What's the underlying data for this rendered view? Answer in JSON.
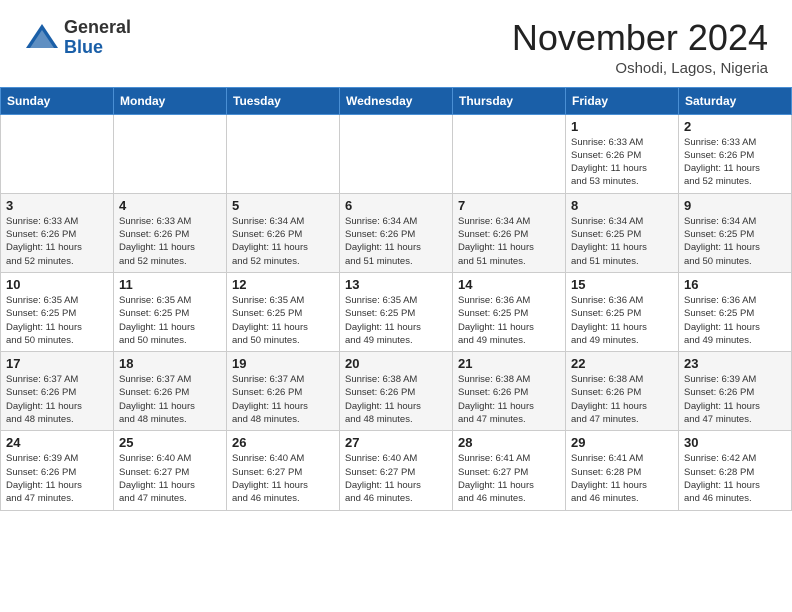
{
  "header": {
    "logo_general": "General",
    "logo_blue": "Blue",
    "month_title": "November 2024",
    "location": "Oshodi, Lagos, Nigeria"
  },
  "weekdays": [
    "Sunday",
    "Monday",
    "Tuesday",
    "Wednesday",
    "Thursday",
    "Friday",
    "Saturday"
  ],
  "weeks": [
    [
      {
        "day": "",
        "info": ""
      },
      {
        "day": "",
        "info": ""
      },
      {
        "day": "",
        "info": ""
      },
      {
        "day": "",
        "info": ""
      },
      {
        "day": "",
        "info": ""
      },
      {
        "day": "1",
        "info": "Sunrise: 6:33 AM\nSunset: 6:26 PM\nDaylight: 11 hours\nand 53 minutes."
      },
      {
        "day": "2",
        "info": "Sunrise: 6:33 AM\nSunset: 6:26 PM\nDaylight: 11 hours\nand 52 minutes."
      }
    ],
    [
      {
        "day": "3",
        "info": "Sunrise: 6:33 AM\nSunset: 6:26 PM\nDaylight: 11 hours\nand 52 minutes."
      },
      {
        "day": "4",
        "info": "Sunrise: 6:33 AM\nSunset: 6:26 PM\nDaylight: 11 hours\nand 52 minutes."
      },
      {
        "day": "5",
        "info": "Sunrise: 6:34 AM\nSunset: 6:26 PM\nDaylight: 11 hours\nand 52 minutes."
      },
      {
        "day": "6",
        "info": "Sunrise: 6:34 AM\nSunset: 6:26 PM\nDaylight: 11 hours\nand 51 minutes."
      },
      {
        "day": "7",
        "info": "Sunrise: 6:34 AM\nSunset: 6:26 PM\nDaylight: 11 hours\nand 51 minutes."
      },
      {
        "day": "8",
        "info": "Sunrise: 6:34 AM\nSunset: 6:25 PM\nDaylight: 11 hours\nand 51 minutes."
      },
      {
        "day": "9",
        "info": "Sunrise: 6:34 AM\nSunset: 6:25 PM\nDaylight: 11 hours\nand 50 minutes."
      }
    ],
    [
      {
        "day": "10",
        "info": "Sunrise: 6:35 AM\nSunset: 6:25 PM\nDaylight: 11 hours\nand 50 minutes."
      },
      {
        "day": "11",
        "info": "Sunrise: 6:35 AM\nSunset: 6:25 PM\nDaylight: 11 hours\nand 50 minutes."
      },
      {
        "day": "12",
        "info": "Sunrise: 6:35 AM\nSunset: 6:25 PM\nDaylight: 11 hours\nand 50 minutes."
      },
      {
        "day": "13",
        "info": "Sunrise: 6:35 AM\nSunset: 6:25 PM\nDaylight: 11 hours\nand 49 minutes."
      },
      {
        "day": "14",
        "info": "Sunrise: 6:36 AM\nSunset: 6:25 PM\nDaylight: 11 hours\nand 49 minutes."
      },
      {
        "day": "15",
        "info": "Sunrise: 6:36 AM\nSunset: 6:25 PM\nDaylight: 11 hours\nand 49 minutes."
      },
      {
        "day": "16",
        "info": "Sunrise: 6:36 AM\nSunset: 6:25 PM\nDaylight: 11 hours\nand 49 minutes."
      }
    ],
    [
      {
        "day": "17",
        "info": "Sunrise: 6:37 AM\nSunset: 6:26 PM\nDaylight: 11 hours\nand 48 minutes."
      },
      {
        "day": "18",
        "info": "Sunrise: 6:37 AM\nSunset: 6:26 PM\nDaylight: 11 hours\nand 48 minutes."
      },
      {
        "day": "19",
        "info": "Sunrise: 6:37 AM\nSunset: 6:26 PM\nDaylight: 11 hours\nand 48 minutes."
      },
      {
        "day": "20",
        "info": "Sunrise: 6:38 AM\nSunset: 6:26 PM\nDaylight: 11 hours\nand 48 minutes."
      },
      {
        "day": "21",
        "info": "Sunrise: 6:38 AM\nSunset: 6:26 PM\nDaylight: 11 hours\nand 47 minutes."
      },
      {
        "day": "22",
        "info": "Sunrise: 6:38 AM\nSunset: 6:26 PM\nDaylight: 11 hours\nand 47 minutes."
      },
      {
        "day": "23",
        "info": "Sunrise: 6:39 AM\nSunset: 6:26 PM\nDaylight: 11 hours\nand 47 minutes."
      }
    ],
    [
      {
        "day": "24",
        "info": "Sunrise: 6:39 AM\nSunset: 6:26 PM\nDaylight: 11 hours\nand 47 minutes."
      },
      {
        "day": "25",
        "info": "Sunrise: 6:40 AM\nSunset: 6:27 PM\nDaylight: 11 hours\nand 47 minutes."
      },
      {
        "day": "26",
        "info": "Sunrise: 6:40 AM\nSunset: 6:27 PM\nDaylight: 11 hours\nand 46 minutes."
      },
      {
        "day": "27",
        "info": "Sunrise: 6:40 AM\nSunset: 6:27 PM\nDaylight: 11 hours\nand 46 minutes."
      },
      {
        "day": "28",
        "info": "Sunrise: 6:41 AM\nSunset: 6:27 PM\nDaylight: 11 hours\nand 46 minutes."
      },
      {
        "day": "29",
        "info": "Sunrise: 6:41 AM\nSunset: 6:28 PM\nDaylight: 11 hours\nand 46 minutes."
      },
      {
        "day": "30",
        "info": "Sunrise: 6:42 AM\nSunset: 6:28 PM\nDaylight: 11 hours\nand 46 minutes."
      }
    ]
  ]
}
